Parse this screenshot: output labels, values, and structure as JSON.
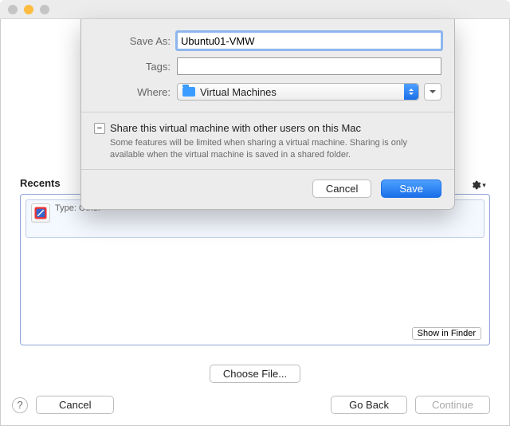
{
  "window": {
    "recents_label": "Recents",
    "choose_file_label": "Choose File...",
    "help_glyph": "?",
    "rec_type_label": "Type:",
    "rec_type_value": "Other",
    "show_in_finder": "Show in Finder",
    "buttons": {
      "cancel": "Cancel",
      "go_back": "Go Back",
      "continue": "Continue"
    }
  },
  "sheet": {
    "labels": {
      "save_as": "Save As:",
      "tags": "Tags:",
      "where": "Where:"
    },
    "save_as_value": "Ubuntu01-VMW",
    "tags_value": "",
    "where_value": "Virtual Machines",
    "share_checkbox_state": "mixed",
    "share_label": "Share this virtual machine with other users on this Mac",
    "share_description": "Some features will be limited when sharing a virtual machine. Sharing is only available when the virtual machine is saved in a shared folder.",
    "buttons": {
      "cancel": "Cancel",
      "save": "Save"
    }
  }
}
